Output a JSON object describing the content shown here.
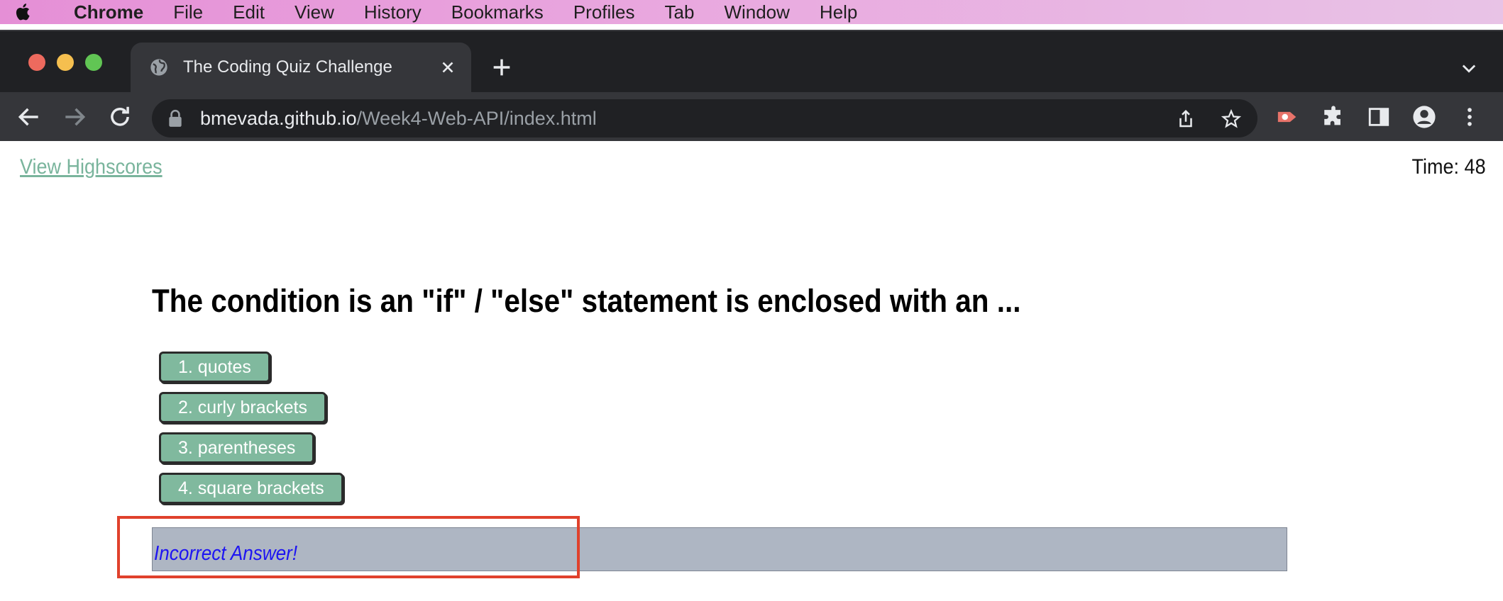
{
  "menubar": {
    "app": "Chrome",
    "items": [
      "File",
      "Edit",
      "View",
      "History",
      "Bookmarks",
      "Profiles",
      "Tab",
      "Window",
      "Help"
    ]
  },
  "browser": {
    "tab_title": "The Coding Quiz Challenge",
    "url_host": "bmevada.github.io",
    "url_path": "/Week4-Web-API/index.html"
  },
  "page": {
    "highscores_link": "View Highscores",
    "timer": "Time: 48",
    "question": "The condition is an \"if\" / \"else\" statement is enclosed with an ...",
    "answers": [
      "1. quotes",
      "2. curly brackets",
      "3. parentheses",
      "4. square brackets"
    ],
    "feedback": "Incorrect Answer!"
  },
  "colors": {
    "accent_green": "#80b99e",
    "link_green": "#79b49c",
    "feedback_bg": "#aeb6c3",
    "feedback_text": "#1d14f2",
    "highlight": "#e0412c"
  },
  "icons": [
    "apple-icon",
    "globe-icon",
    "close-icon",
    "plus-icon",
    "chevron-down-icon",
    "back-icon",
    "forward-icon",
    "reload-icon",
    "lock-icon",
    "share-icon",
    "star-icon",
    "screencast-extension-icon",
    "puzzle-icon",
    "side-panel-icon",
    "profile-icon",
    "more-icon"
  ]
}
